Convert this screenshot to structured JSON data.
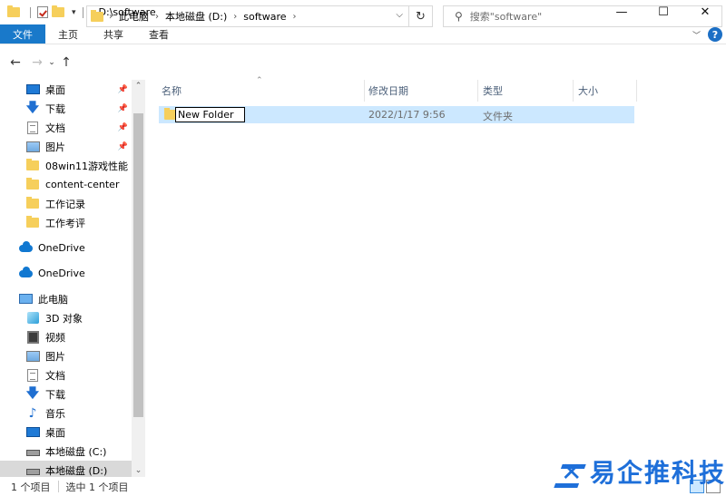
{
  "window": {
    "title": "D:\\software",
    "controls": {
      "minimize": "—",
      "maximize": "☐",
      "close": "✕"
    }
  },
  "ribbon": {
    "tabs": [
      "文件",
      "主页",
      "共享",
      "查看"
    ],
    "help": "?"
  },
  "address": {
    "crumbs": [
      "此电脑",
      "本地磁盘 (D:)",
      "software"
    ],
    "search_placeholder": "搜索\"software\""
  },
  "sidebar": {
    "quick_access": [
      {
        "label": "桌面",
        "icon": "desktop-icon",
        "pinned": true
      },
      {
        "label": "下载",
        "icon": "download-icon",
        "pinned": true
      },
      {
        "label": "文档",
        "icon": "document-icon",
        "pinned": true
      },
      {
        "label": "图片",
        "icon": "pictures-icon",
        "pinned": true
      },
      {
        "label": "08win11游戏性能",
        "icon": "folder-icon",
        "pinned": false
      },
      {
        "label": "content-center",
        "icon": "folder-icon",
        "pinned": false
      },
      {
        "label": "工作记录",
        "icon": "folder-icon",
        "pinned": false
      },
      {
        "label": "工作考评",
        "icon": "folder-icon",
        "pinned": false
      }
    ],
    "onedrive_1": "OneDrive",
    "onedrive_2": "OneDrive",
    "this_pc": "此电脑",
    "pc_items": [
      {
        "label": "3D 对象",
        "icon": "3d-objects-icon"
      },
      {
        "label": "视频",
        "icon": "video-icon"
      },
      {
        "label": "图片",
        "icon": "pictures-icon"
      },
      {
        "label": "文档",
        "icon": "document-icon"
      },
      {
        "label": "下载",
        "icon": "download-icon"
      },
      {
        "label": "音乐",
        "icon": "music-icon"
      },
      {
        "label": "桌面",
        "icon": "desktop-icon"
      },
      {
        "label": "本地磁盘 (C:)",
        "icon": "drive-icon"
      },
      {
        "label": "本地磁盘 (D:)",
        "icon": "drive-icon",
        "selected": true
      }
    ]
  },
  "columns": {
    "name": "名称",
    "modified": "修改日期",
    "type": "类型",
    "size": "大小"
  },
  "files": [
    {
      "name": "New Folder",
      "modified": "2022/1/17 9:56",
      "type": "文件夹",
      "size": ""
    }
  ],
  "status": {
    "count": "1 个项目",
    "selected": "选中 1 个项目"
  },
  "watermark": {
    "text": "易企推科技"
  },
  "colors": {
    "accent": "#1979ca",
    "selection": "#cce8ff",
    "folder": "#f6cf5b"
  }
}
